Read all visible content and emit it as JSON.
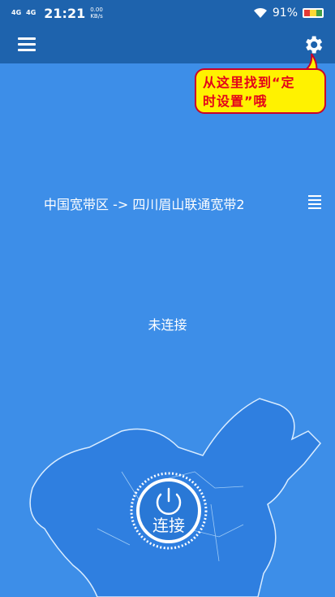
{
  "statusbar": {
    "signal1": "4G",
    "signal2": "4G",
    "time": "21:21",
    "speed_value": "0.00",
    "speed_unit": "KB/s",
    "battery": "91%"
  },
  "toolbar": {
    "menu_icon": "hamburger-menu-icon",
    "settings_icon": "gear-icon"
  },
  "callout": {
    "line1": "从这里找到“定",
    "line2": "时设置”哦"
  },
  "route": {
    "text": "中国宽带区 -> 四川眉山联通宽带2",
    "list_icon": "server-list-icon"
  },
  "status": {
    "text": "未连接"
  },
  "connect_button": {
    "label": "连接",
    "icon": "power-icon"
  },
  "colors": {
    "background": "#3d8ee8",
    "toolbar": "#1e63ad",
    "callout_bg": "#fff200",
    "callout_text": "#e4001b"
  }
}
